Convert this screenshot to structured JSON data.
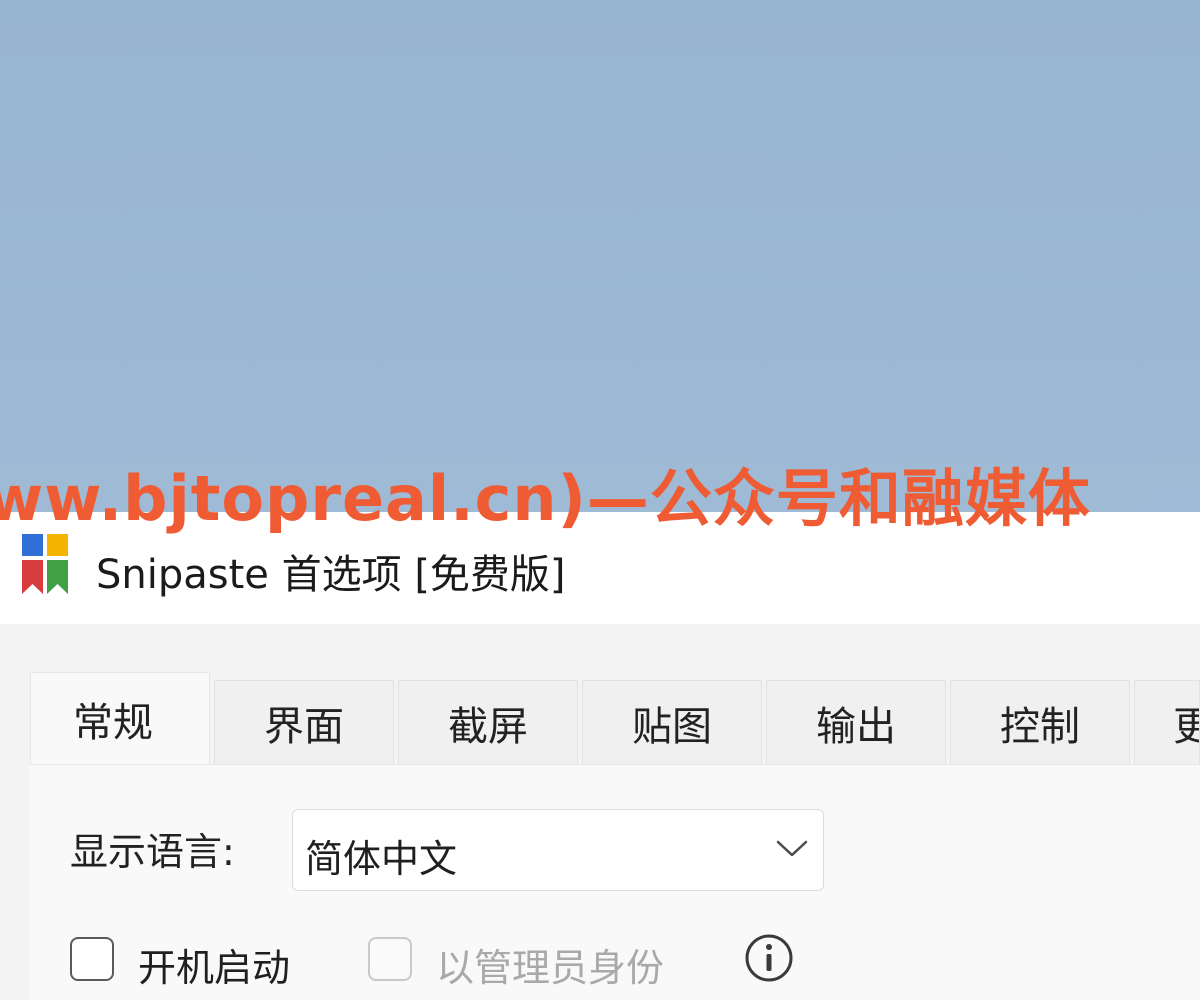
{
  "watermark": {
    "text": "ww.bjtopreal.cn)—公众号和融媒体"
  },
  "window": {
    "title": "Snipaste 首选项 [免费版]",
    "logo_icon": "snipaste-logo-icon"
  },
  "tabs": [
    {
      "label": "常规",
      "active": true
    },
    {
      "label": "界面",
      "active": false
    },
    {
      "label": "截屏",
      "active": false
    },
    {
      "label": "贴图",
      "active": false
    },
    {
      "label": "输出",
      "active": false
    },
    {
      "label": "控制",
      "active": false
    },
    {
      "label": "更",
      "active": false
    }
  ],
  "general": {
    "language_label": "显示语言:",
    "language_value": "简体中文",
    "dropdown_icon": "chevron-down-icon",
    "startup_label": "开机启动",
    "startup_checked": false,
    "admin_label": "以管理员身份",
    "admin_checked": false,
    "admin_enabled": false,
    "info_icon": "info-icon"
  },
  "colors": {
    "watermark": "#ef5b33",
    "desktop": "#9db9d5",
    "window_bg": "#f3f3f3",
    "titlebar_bg": "#ffffff"
  }
}
